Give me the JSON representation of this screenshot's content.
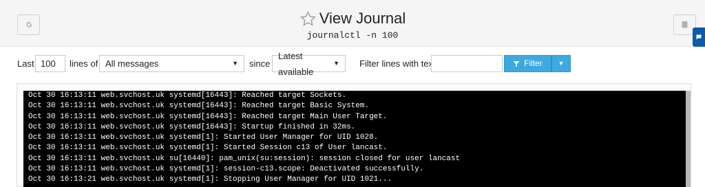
{
  "header": {
    "title": "View Journal",
    "subtitle": "journalctl -n 100",
    "left_icon": "gear-icon",
    "right_icon": "book-icon",
    "favorite_icon": "star-outline-icon"
  },
  "toolbar": {
    "last_label": "Last",
    "lines_value": "100",
    "lines_of_label": "lines of",
    "messages_select": "All messages",
    "since_label": "since",
    "since_select": "Latest available",
    "filter_label": "Filter lines with text",
    "filter_value": "",
    "filter_button": "Filter"
  },
  "log": {
    "lines": [
      "Oct 30 16:13:11 web.svchost.uk systemd[16443]: Reached target Sockets.",
      "Oct 30 16:13:11 web.svchost.uk systemd[16443]: Reached target Basic System.",
      "Oct 30 16:13:11 web.svchost.uk systemd[16443]: Reached target Main User Target.",
      "Oct 30 16:13:11 web.svchost.uk systemd[16443]: Startup finished in 32ms.",
      "Oct 30 16:13:11 web.svchost.uk systemd[1]: Started User Manager for UID 1028.",
      "Oct 30 16:13:11 web.svchost.uk systemd[1]: Started Session c13 of User lancast.",
      "Oct 30 16:13:11 web.svchost.uk su[16440]: pam_unix(su:session): session closed for user lancast",
      "Oct 30 16:13:11 web.svchost.uk systemd[1]: session-c13.scope: Deactivated successfully.",
      "Oct 30 16:13:21 web.svchost.uk systemd[1]: Stopping User Manager for UID 1021..."
    ]
  },
  "colors": {
    "accent": "#3da9e0",
    "side_tab": "#0b5bab",
    "log_bg": "#000000"
  }
}
